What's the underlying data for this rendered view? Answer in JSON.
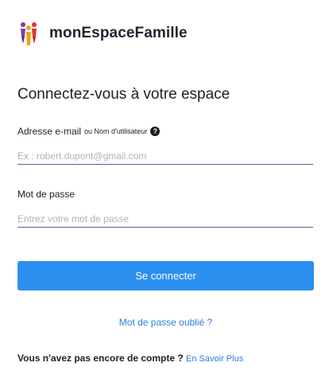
{
  "brand": {
    "name": "monEspaceFamille",
    "logo_icon": "family-people-logo-icon"
  },
  "login": {
    "title": "Connectez-vous à votre espace",
    "email_label": "Adresse e-mail",
    "email_label_suffix": "ou Nom d'utilisateur",
    "email_placeholder": "Ex : robert.dupont@gmail.com",
    "email_value": "",
    "password_label": "Mot de passe",
    "password_placeholder": "Entrez votre mot de passe",
    "password_value": "",
    "submit_label": "Se connecter",
    "forgot_label": "Mot de passe oublié ?",
    "no_account_question": "Vous n'avez pas encore de compte ?",
    "learn_more_label": "En Savoir Plus"
  },
  "colors": {
    "primary_button": "#2b8ff0",
    "link": "#2b7fd6",
    "field_underline": "#7a4e96"
  }
}
